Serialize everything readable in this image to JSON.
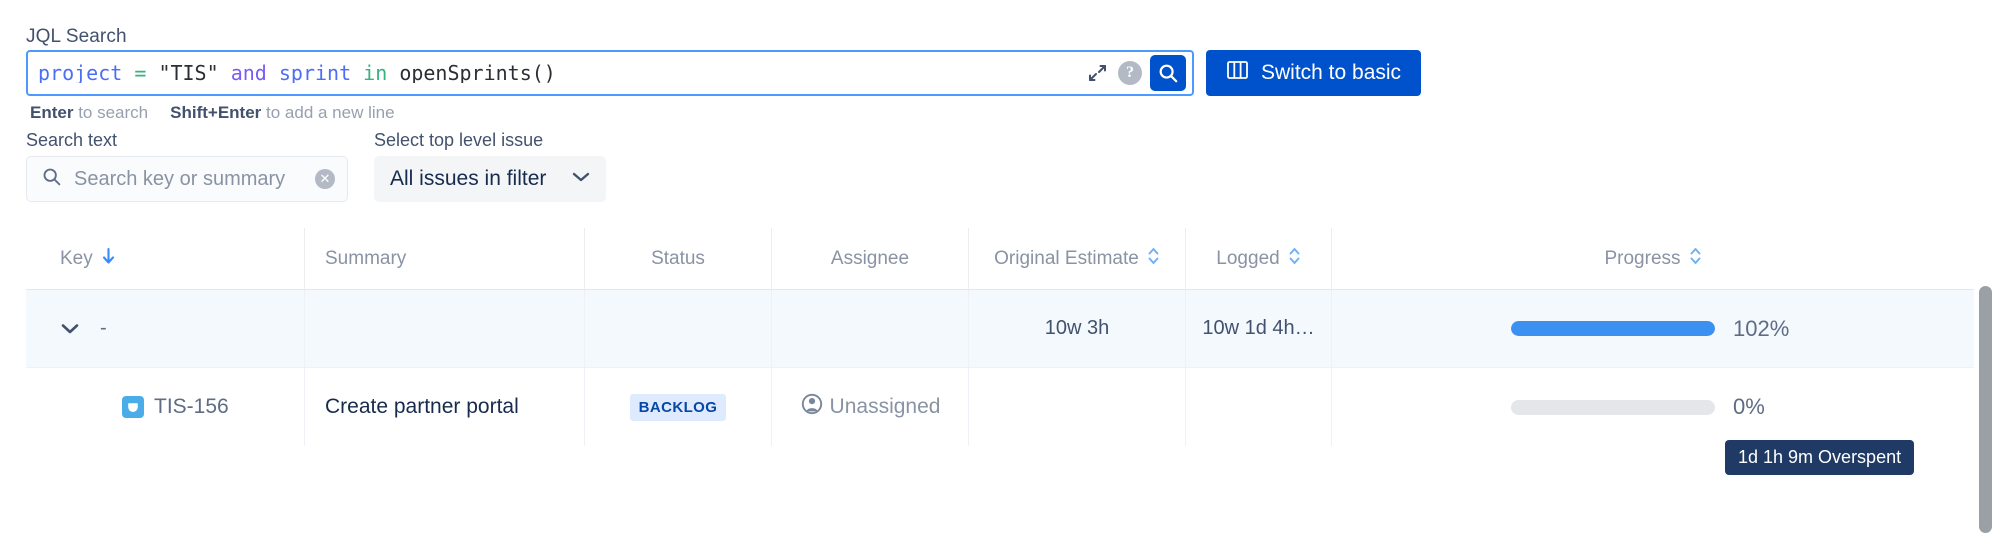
{
  "jql": {
    "label": "JQL Search",
    "tokens": [
      {
        "t": "project",
        "k": "field"
      },
      {
        "t": " ",
        "k": "plain"
      },
      {
        "t": "=",
        "k": "op"
      },
      {
        "t": " ",
        "k": "plain"
      },
      {
        "t": "\"TIS\"",
        "k": "str"
      },
      {
        "t": " ",
        "k": "plain"
      },
      {
        "t": "and",
        "k": "kw"
      },
      {
        "t": " ",
        "k": "plain"
      },
      {
        "t": "sprint",
        "k": "field"
      },
      {
        "t": " ",
        "k": "plain"
      },
      {
        "t": "in",
        "k": "op"
      },
      {
        "t": " ",
        "k": "plain"
      },
      {
        "t": "openSprints()",
        "k": "fn"
      }
    ],
    "value": "project = \"TIS\" and sprint in openSprints()",
    "expand_icon": "expand-icon",
    "help_icon": "help-icon",
    "help_glyph": "?",
    "search_icon": "search-icon",
    "switch_button": "Switch to basic",
    "switch_icon": "board-columns-icon"
  },
  "hint": {
    "enter_key": "Enter",
    "enter_text": " to search",
    "shift_key": "Shift+Enter",
    "shift_text": " to add a new line"
  },
  "filters": {
    "search_text": {
      "label": "Search text",
      "placeholder": "Search key or summary",
      "value": "",
      "icon": "search-icon",
      "clear_glyph": "✕"
    },
    "top_level": {
      "label": "Select top level issue",
      "selected": "All issues in filter",
      "chevron": "chevron-down-icon"
    }
  },
  "table": {
    "columns": [
      {
        "key": "key",
        "label": "Key",
        "sort": "desc"
      },
      {
        "key": "summary",
        "label": "Summary",
        "sort": "none"
      },
      {
        "key": "status",
        "label": "Status",
        "sort": "none"
      },
      {
        "key": "assignee",
        "label": "Assignee",
        "sort": "none"
      },
      {
        "key": "estimate",
        "label": "Original Estimate",
        "sort": "both"
      },
      {
        "key": "logged",
        "label": "Logged",
        "sort": "both"
      },
      {
        "key": "progress",
        "label": "Progress",
        "sort": "both"
      }
    ],
    "rows": [
      {
        "type": "group",
        "expanded": true,
        "key": "-",
        "summary": "",
        "status": "",
        "assignee": "",
        "estimate": "10w 3h",
        "logged": "10w 1d 4h…",
        "progress_pct": "102%",
        "progress_fill": 100
      },
      {
        "type": "issue",
        "issue_type": "story-icon",
        "key": "TIS-156",
        "summary": "Create partner portal",
        "status": "BACKLOG",
        "assignee": "Unassigned",
        "estimate": "",
        "logged": "",
        "progress_pct": "0%",
        "progress_fill": 0
      }
    ]
  },
  "tooltip": {
    "text": "1d 1h 9m Overspent"
  },
  "colors": {
    "accent": "#0052cc",
    "focus_border": "#4c9aff",
    "progress_fill": "#3b90f0",
    "badge_bg": "#deebff",
    "badge_text": "#0747a6",
    "tooltip_bg": "#1f3a64",
    "row_highlight": "#f4f9fe"
  }
}
